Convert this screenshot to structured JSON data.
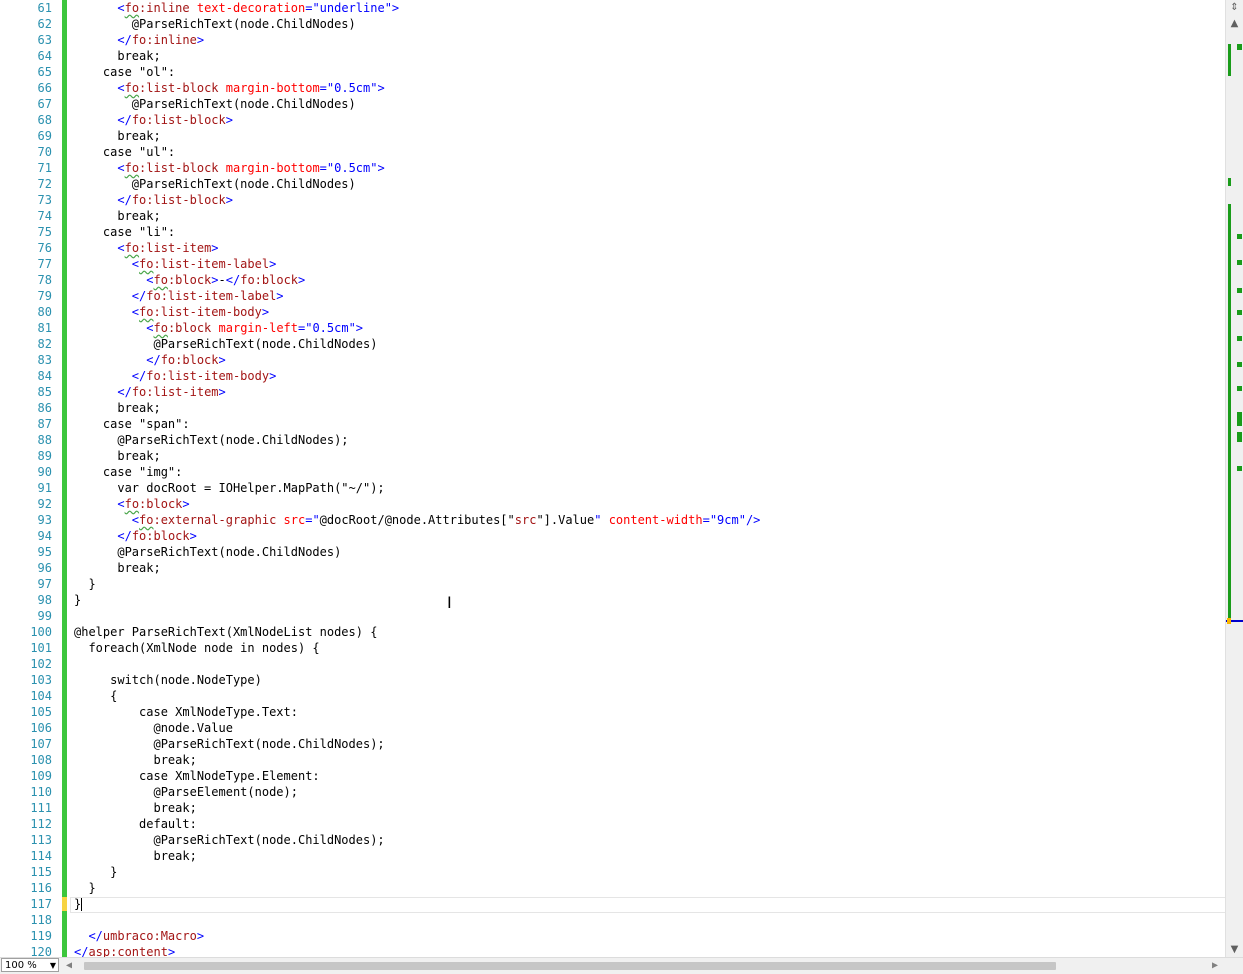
{
  "editor": {
    "zoom_label": "100 %",
    "lines": [
      {
        "n": "61",
        "segs": [
          [
            "s",
            "      "
          ],
          [
            "v",
            "<"
          ],
          [
            "ns",
            "fo"
          ],
          [
            "t",
            ":inline "
          ],
          [
            "a",
            "text-decoration"
          ],
          [
            "v",
            "=\"underline\">"
          ]
        ]
      },
      {
        "n": "62",
        "segs": [
          [
            "s",
            "        @ParseRichText(node.ChildNodes)"
          ]
        ]
      },
      {
        "n": "63",
        "segs": [
          [
            "s",
            "      "
          ],
          [
            "v",
            "</"
          ],
          [
            "n",
            "fo"
          ],
          [
            "t",
            ":inline"
          ],
          [
            "v",
            ">"
          ]
        ]
      },
      {
        "n": "64",
        "segs": [
          [
            "s",
            "      break;"
          ]
        ]
      },
      {
        "n": "65",
        "segs": [
          [
            "s",
            "    case \"ol\":"
          ]
        ]
      },
      {
        "n": "66",
        "segs": [
          [
            "s",
            "      "
          ],
          [
            "v",
            "<"
          ],
          [
            "ns",
            "fo"
          ],
          [
            "t",
            ":list-block "
          ],
          [
            "a",
            "margin-bottom"
          ],
          [
            "v",
            "=\"0.5cm\">"
          ]
        ]
      },
      {
        "n": "67",
        "segs": [
          [
            "s",
            "        @ParseRichText(node.ChildNodes)"
          ]
        ]
      },
      {
        "n": "68",
        "segs": [
          [
            "s",
            "      "
          ],
          [
            "v",
            "</"
          ],
          [
            "n",
            "fo"
          ],
          [
            "t",
            ":list-block"
          ],
          [
            "v",
            ">"
          ]
        ]
      },
      {
        "n": "69",
        "segs": [
          [
            "s",
            "      break;"
          ]
        ]
      },
      {
        "n": "70",
        "segs": [
          [
            "s",
            "    case \"ul\":"
          ]
        ]
      },
      {
        "n": "71",
        "segs": [
          [
            "s",
            "      "
          ],
          [
            "v",
            "<"
          ],
          [
            "ns",
            "fo"
          ],
          [
            "t",
            ":list-block "
          ],
          [
            "a",
            "margin-bottom"
          ],
          [
            "v",
            "=\"0.5cm\">"
          ]
        ]
      },
      {
        "n": "72",
        "segs": [
          [
            "s",
            "        @ParseRichText(node.ChildNodes)"
          ]
        ]
      },
      {
        "n": "73",
        "segs": [
          [
            "s",
            "      "
          ],
          [
            "v",
            "</"
          ],
          [
            "n",
            "fo"
          ],
          [
            "t",
            ":list-block"
          ],
          [
            "v",
            ">"
          ]
        ]
      },
      {
        "n": "74",
        "segs": [
          [
            "s",
            "      break;"
          ]
        ]
      },
      {
        "n": "75",
        "segs": [
          [
            "s",
            "    case \"li\":"
          ]
        ]
      },
      {
        "n": "76",
        "segs": [
          [
            "s",
            "      "
          ],
          [
            "v",
            "<"
          ],
          [
            "ns",
            "fo"
          ],
          [
            "t",
            ":list-item"
          ],
          [
            "v",
            ">"
          ]
        ]
      },
      {
        "n": "77",
        "segs": [
          [
            "s",
            "        "
          ],
          [
            "v",
            "<"
          ],
          [
            "ns",
            "fo"
          ],
          [
            "t",
            ":list-item-label"
          ],
          [
            "v",
            ">"
          ]
        ]
      },
      {
        "n": "78",
        "segs": [
          [
            "s",
            "          "
          ],
          [
            "v",
            "<"
          ],
          [
            "ns",
            "fo"
          ],
          [
            "t",
            ":block"
          ],
          [
            "v",
            ">"
          ],
          [
            "s",
            "-"
          ],
          [
            "v",
            "</"
          ],
          [
            "n",
            "fo"
          ],
          [
            "t",
            ":block"
          ],
          [
            "v",
            ">"
          ]
        ]
      },
      {
        "n": "79",
        "segs": [
          [
            "s",
            "        "
          ],
          [
            "v",
            "</"
          ],
          [
            "n",
            "fo"
          ],
          [
            "t",
            ":list-item-label"
          ],
          [
            "v",
            ">"
          ]
        ]
      },
      {
        "n": "80",
        "segs": [
          [
            "s",
            "        "
          ],
          [
            "v",
            "<"
          ],
          [
            "ns",
            "fo"
          ],
          [
            "t",
            ":list-item-body"
          ],
          [
            "v",
            ">"
          ]
        ]
      },
      {
        "n": "81",
        "segs": [
          [
            "s",
            "          "
          ],
          [
            "v",
            "<"
          ],
          [
            "ns",
            "fo"
          ],
          [
            "t",
            ":block "
          ],
          [
            "a",
            "margin-left"
          ],
          [
            "v",
            "=\"0.5cm\">"
          ]
        ]
      },
      {
        "n": "82",
        "segs": [
          [
            "s",
            "           @ParseRichText(node.ChildNodes)"
          ]
        ]
      },
      {
        "n": "83",
        "segs": [
          [
            "s",
            "          "
          ],
          [
            "v",
            "</"
          ],
          [
            "n",
            "fo"
          ],
          [
            "t",
            ":block"
          ],
          [
            "v",
            ">"
          ]
        ]
      },
      {
        "n": "84",
        "segs": [
          [
            "s",
            "        "
          ],
          [
            "v",
            "</"
          ],
          [
            "n",
            "fo"
          ],
          [
            "t",
            ":list-item-body"
          ],
          [
            "v",
            ">"
          ]
        ]
      },
      {
        "n": "85",
        "segs": [
          [
            "s",
            "      "
          ],
          [
            "v",
            "</"
          ],
          [
            "n",
            "fo"
          ],
          [
            "t",
            ":list-item"
          ],
          [
            "v",
            ">"
          ]
        ]
      },
      {
        "n": "86",
        "segs": [
          [
            "s",
            "      break;"
          ]
        ]
      },
      {
        "n": "87",
        "segs": [
          [
            "s",
            "    case \"span\":"
          ]
        ]
      },
      {
        "n": "88",
        "segs": [
          [
            "s",
            "      @ParseRichText(node.ChildNodes);"
          ]
        ]
      },
      {
        "n": "89",
        "segs": [
          [
            "s",
            "      break;"
          ]
        ]
      },
      {
        "n": "90",
        "segs": [
          [
            "s",
            "    case \"img\":"
          ]
        ]
      },
      {
        "n": "91",
        "segs": [
          [
            "s",
            "      var docRoot = IOHelper.MapPath(\"~/\");"
          ]
        ]
      },
      {
        "n": "92",
        "segs": [
          [
            "s",
            "      "
          ],
          [
            "v",
            "<"
          ],
          [
            "ns",
            "fo"
          ],
          [
            "t",
            ":block"
          ],
          [
            "v",
            ">"
          ]
        ]
      },
      {
        "n": "93",
        "segs": [
          [
            "s",
            "        "
          ],
          [
            "v",
            "<"
          ],
          [
            "ns",
            "fo"
          ],
          [
            "t",
            ":external-graphic "
          ],
          [
            "a",
            "src"
          ],
          [
            "v",
            "=\""
          ],
          [
            "s",
            "@docRoot/@node.Attributes[\""
          ],
          [
            "t",
            "src"
          ],
          [
            "s",
            "\"].Value"
          ],
          [
            "v",
            "\" "
          ],
          [
            "a",
            "content-width"
          ],
          [
            "v",
            "=\"9cm\"/>"
          ]
        ]
      },
      {
        "n": "94",
        "segs": [
          [
            "s",
            "      "
          ],
          [
            "v",
            "</"
          ],
          [
            "n",
            "fo"
          ],
          [
            "t",
            ":block"
          ],
          [
            "v",
            ">"
          ]
        ]
      },
      {
        "n": "95",
        "segs": [
          [
            "s",
            "      @ParseRichText(node.ChildNodes)"
          ]
        ]
      },
      {
        "n": "96",
        "segs": [
          [
            "s",
            "      break;"
          ]
        ]
      },
      {
        "n": "97",
        "segs": [
          [
            "s",
            "  }"
          ]
        ]
      },
      {
        "n": "98",
        "segs": [
          [
            "s",
            "}"
          ]
        ]
      },
      {
        "n": "99",
        "segs": [
          [
            "s",
            ""
          ]
        ]
      },
      {
        "n": "100",
        "segs": [
          [
            "s",
            "@helper ParseRichText(XmlNodeList nodes) {"
          ]
        ]
      },
      {
        "n": "101",
        "segs": [
          [
            "s",
            "  foreach(XmlNode node in nodes) {"
          ]
        ]
      },
      {
        "n": "102",
        "segs": [
          [
            "s",
            ""
          ]
        ]
      },
      {
        "n": "103",
        "segs": [
          [
            "s",
            "     switch(node.NodeType)"
          ]
        ]
      },
      {
        "n": "104",
        "segs": [
          [
            "s",
            "     {"
          ]
        ]
      },
      {
        "n": "105",
        "segs": [
          [
            "s",
            "         case XmlNodeType.Text:"
          ]
        ]
      },
      {
        "n": "106",
        "segs": [
          [
            "s",
            "           @node.Value"
          ]
        ]
      },
      {
        "n": "107",
        "segs": [
          [
            "s",
            "           @ParseRichText(node.ChildNodes);"
          ]
        ]
      },
      {
        "n": "108",
        "segs": [
          [
            "s",
            "           break;"
          ]
        ]
      },
      {
        "n": "109",
        "segs": [
          [
            "s",
            "         case XmlNodeType.Element:"
          ]
        ]
      },
      {
        "n": "110",
        "segs": [
          [
            "s",
            "           @ParseElement(node);"
          ]
        ]
      },
      {
        "n": "111",
        "segs": [
          [
            "s",
            "           break;"
          ]
        ]
      },
      {
        "n": "112",
        "segs": [
          [
            "s",
            "         default:"
          ]
        ]
      },
      {
        "n": "113",
        "segs": [
          [
            "s",
            "           @ParseRichText(node.ChildNodes);"
          ]
        ]
      },
      {
        "n": "114",
        "segs": [
          [
            "s",
            "           break;"
          ]
        ]
      },
      {
        "n": "115",
        "segs": [
          [
            "s",
            "     }"
          ]
        ]
      },
      {
        "n": "116",
        "segs": [
          [
            "s",
            "  }"
          ]
        ]
      },
      {
        "n": "117",
        "segs": [
          [
            "s",
            "}"
          ]
        ]
      },
      {
        "n": "118",
        "segs": [
          [
            "s",
            ""
          ]
        ]
      },
      {
        "n": "119",
        "segs": [
          [
            "s",
            "  "
          ],
          [
            "v",
            "</"
          ],
          [
            "t",
            "umbraco:Macro"
          ],
          [
            "v",
            ">"
          ]
        ]
      },
      {
        "n": "120",
        "segs": [
          [
            "v",
            "</"
          ],
          [
            "t",
            "asp:content"
          ],
          [
            "v",
            ">"
          ]
        ]
      }
    ]
  }
}
